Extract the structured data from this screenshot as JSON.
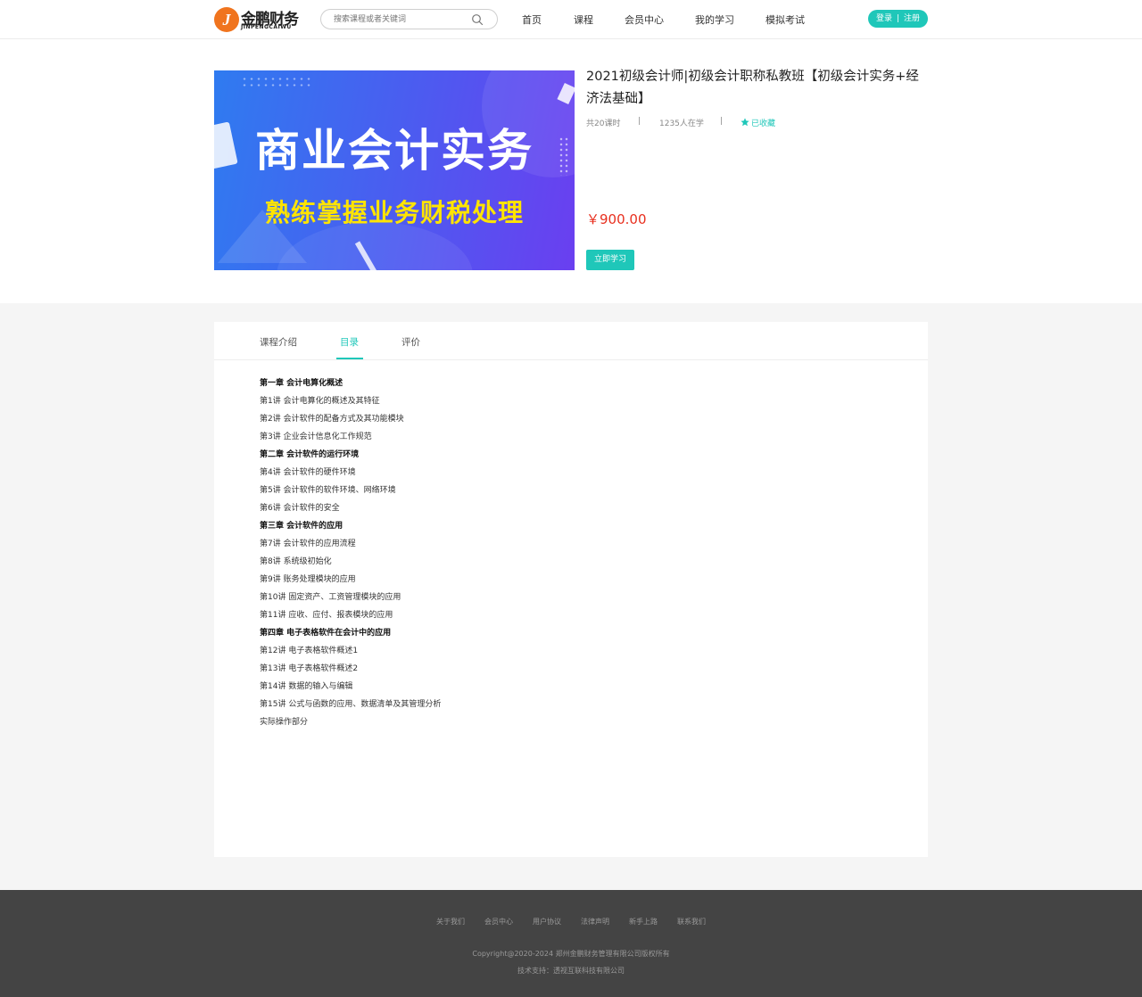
{
  "header": {
    "logo_text": "金鹏财务",
    "logo_sub": "JINPENGCAIWU",
    "search_placeholder": "搜索课程或者关键词",
    "nav": [
      "首页",
      "课程",
      "会员中心",
      "我的学习",
      "模拟考试"
    ],
    "login_label": "登录",
    "auth_separator": "|",
    "register_label": "注册"
  },
  "course": {
    "banner_title": "商业会计实务",
    "banner_subtitle": "熟练掌握业务财税处理",
    "title": "2021初级会计师|初级会计职称私教班【初级会计实务+经济法基础】",
    "lessons": "共20课时",
    "learners": "1235人在学",
    "meta_separator": "|",
    "favorite_label": "已收藏",
    "price": "￥900.00",
    "start_label": "立即学习"
  },
  "tabs": [
    "课程介绍",
    "目录",
    "评价"
  ],
  "active_tab": "目录",
  "toc": [
    {
      "text": "第一章 会计电算化概述",
      "chapter": true
    },
    {
      "text": "第1讲 会计电算化的概述及其特征",
      "chapter": false
    },
    {
      "text": "第2讲 会计软件的配备方式及其功能模块",
      "chapter": false
    },
    {
      "text": "第3讲 企业会计信息化工作规范",
      "chapter": false
    },
    {
      "text": "第二章 会计软件的运行环境",
      "chapter": true
    },
    {
      "text": "第4讲 会计软件的硬件环境",
      "chapter": false
    },
    {
      "text": "第5讲 会计软件的软件环境、网络环境",
      "chapter": false
    },
    {
      "text": "第6讲 会计软件的安全",
      "chapter": false
    },
    {
      "text": "第三章 会计软件的应用",
      "chapter": true
    },
    {
      "text": "第7讲 会计软件的应用流程",
      "chapter": false
    },
    {
      "text": "第8讲 系统级初始化",
      "chapter": false
    },
    {
      "text": "第9讲 账务处理模块的应用",
      "chapter": false
    },
    {
      "text": "第10讲 固定资产、工资管理模块的应用",
      "chapter": false
    },
    {
      "text": "第11讲 应收、应付、报表模块的应用",
      "chapter": false
    },
    {
      "text": "第四章 电子表格软件在会计中的应用",
      "chapter": true
    },
    {
      "text": "第12讲 电子表格软件概述1",
      "chapter": false
    },
    {
      "text": "第13讲 电子表格软件概述2",
      "chapter": false
    },
    {
      "text": "第14讲 数据的输入与编辑",
      "chapter": false
    },
    {
      "text": "第15讲 公式与函数的应用、数据清单及其管理分析",
      "chapter": false
    },
    {
      "text": "实际操作部分",
      "chapter": false
    }
  ],
  "footer": {
    "links": [
      "关于我们",
      "会员中心",
      "用户协议",
      "法律声明",
      "新手上路",
      "联系我们"
    ],
    "copyright": "Copyright@2020-2024 郑州金鹏财务管理有限公司版权所有",
    "tech": "技术支持：透视互联科技有限公司"
  },
  "colors": {
    "accent": "#1fc7b9",
    "price": "#e8301f",
    "logo": "#f0741e",
    "footer_bg": "#444444"
  }
}
